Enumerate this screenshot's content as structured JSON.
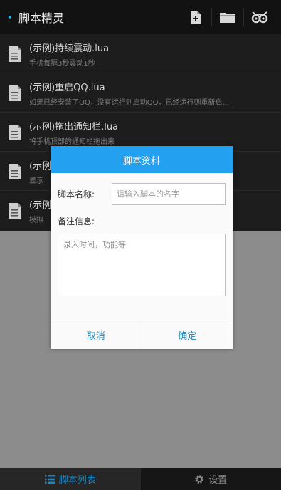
{
  "app": {
    "title": "脚本精灵"
  },
  "toolbar": {
    "icons": [
      "new-file-icon",
      "folder-icon",
      "bug-icon"
    ]
  },
  "scripts": [
    {
      "name": "(示例)持续震动.lua",
      "desc": "手机每隔3秒震动1秒"
    },
    {
      "name": "(示例)重启QQ.lua",
      "desc": "如果已经安装了QQ，没有运行则启动QQ，已经运行则重新启..."
    },
    {
      "name": "(示例)拖出通知栏.lua",
      "desc": "将手机顶部的通知栏拖出来"
    },
    {
      "name": "(示例",
      "desc": "显示"
    },
    {
      "name": "(示例",
      "desc": "模拟"
    }
  ],
  "dialog": {
    "title": "脚本资料",
    "name_label": "脚本名称:",
    "name_placeholder": "请输入脚本的名字",
    "note_label": "备注信息:",
    "note_placeholder": "录入时间，功能等",
    "cancel": "取消",
    "confirm": "确定"
  },
  "bottom_nav": {
    "tabs": [
      {
        "label": "脚本列表",
        "icon": "list-icon",
        "active": true
      },
      {
        "label": "设置",
        "icon": "gear-icon",
        "active": false
      }
    ]
  },
  "colors": {
    "accent": "#24a0f0",
    "link": "#1f86c0"
  }
}
